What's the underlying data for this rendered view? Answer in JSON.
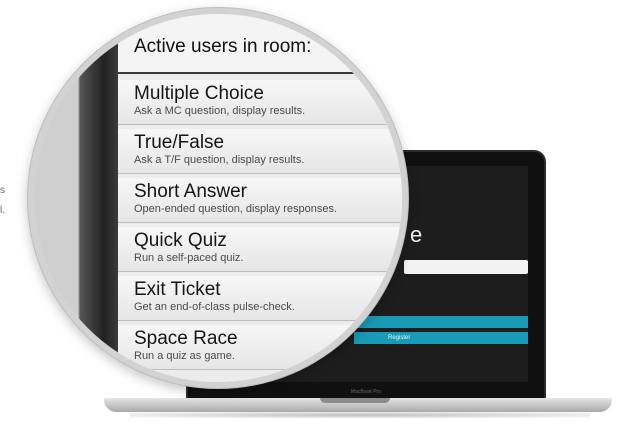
{
  "edge_text": [
    "s",
    "l."
  ],
  "magnifier": {
    "header": "Active users in room:",
    "menu": [
      {
        "title": "Multiple Choice",
        "desc": "Ask a MC question, display results."
      },
      {
        "title": "True/False",
        "desc": "Ask a T/F question, display results."
      },
      {
        "title": "Short Answer",
        "desc": "Open-ended question, display responses."
      },
      {
        "title": "Quick Quiz",
        "desc": "Run a self-paced quiz."
      },
      {
        "title": "Exit Ticket",
        "desc": "Get an end-of-class pulse-check."
      },
      {
        "title": "Space Race",
        "desc": "Run a quiz as game."
      }
    ],
    "chevron_icon": "chevron-right-icon"
  },
  "laptop": {
    "screen_title": "e",
    "button_labels": [
      "",
      "Register"
    ],
    "bezel_label": "MacBook Pro"
  },
  "colors": {
    "accent": "#1a9bb5",
    "panel": "#ececec",
    "bezel": "#101010"
  }
}
